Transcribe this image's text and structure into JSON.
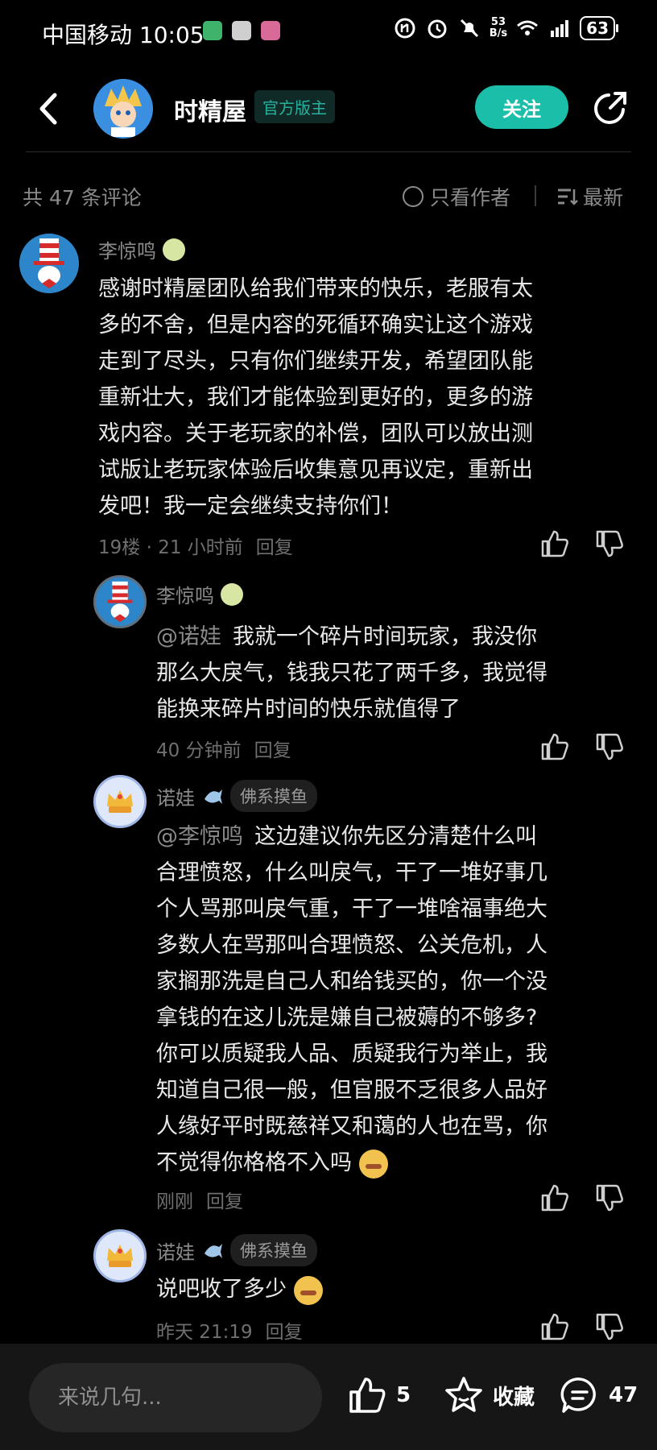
{
  "status_bar": {
    "carrier_time": "中国移动 10:05",
    "network_speed_top": "53",
    "network_speed_bottom": "B/s",
    "battery": "63"
  },
  "header": {
    "title": "时精屋",
    "badge": "官方版主",
    "follow_label": "关注"
  },
  "sort_bar": {
    "comment_count": "共 47 条评论",
    "author_only": "只看作者",
    "sort_label": "最新"
  },
  "comments": [
    {
      "user": "李惊鸣",
      "lines": [
        "感谢时精屋团队给我们带来的快乐，老服有太",
        "多的不舍，但是内容的死循环确实让这个游戏",
        "走到了尽头，只有你们继续开发，希望团队能",
        "重新壮大，我们才能体验到更好的，更多的游",
        "戏内容。关于老玩家的补偿，团队可以放出测",
        "试版让老玩家体验后收集意见再议定，重新出",
        "发吧！我一定会继续支持你们！"
      ],
      "meta": "19楼 · 21 小时前",
      "reply": "回复"
    }
  ],
  "replies": [
    {
      "user": "李惊鸣",
      "mention": "@诺娃",
      "lines": [
        "我就一个碎片时间玩家，我没你",
        "那么大戾气，钱我只花了两千多，我觉得",
        "能换来碎片时间的快乐就值得了"
      ],
      "meta": "40 分钟前",
      "reply": "回复"
    },
    {
      "user": "诺娃",
      "tag": "佛系摸鱼",
      "mention": "@李惊鸣",
      "lines": [
        "这边建议你先区分清楚什么叫",
        "合理愤怒，什么叫戾气，干了一堆好事几",
        "个人骂那叫戾气重，干了一堆啥福事绝大",
        "多数人在骂那叫合理愤怒、公关危机，人",
        "家搁那洗是自己人和给钱买的，你一个没",
        "拿钱的在这儿洗是嫌自己被薅的不够多?",
        "你可以质疑我人品、质疑我行为举止，我",
        "知道自己很一般，但官服不乏很多人品好",
        "人缘好平时既慈祥又和蔼的人也在骂，你",
        "不觉得你格格不入吗"
      ],
      "meta": "刚刚",
      "reply": "回复"
    },
    {
      "user": "诺娃",
      "tag": "佛系摸鱼",
      "text": "说吧收了多少",
      "meta": "昨天 21:19",
      "reply": "回复"
    }
  ],
  "bottom_bar": {
    "input_placeholder": "来说几句...",
    "like_count": "5",
    "collect_label": "收藏",
    "comment_count": "47"
  },
  "icons": {
    "back": "back-arrow-icon",
    "share": "share-icon",
    "like": "thumb-up-icon",
    "dislike": "thumb-down-icon",
    "collect": "star-icon",
    "comment": "comment-icon"
  },
  "colors": {
    "accent": "#1bbfa9",
    "background": "#000000",
    "bottom_bar": "#161616"
  }
}
